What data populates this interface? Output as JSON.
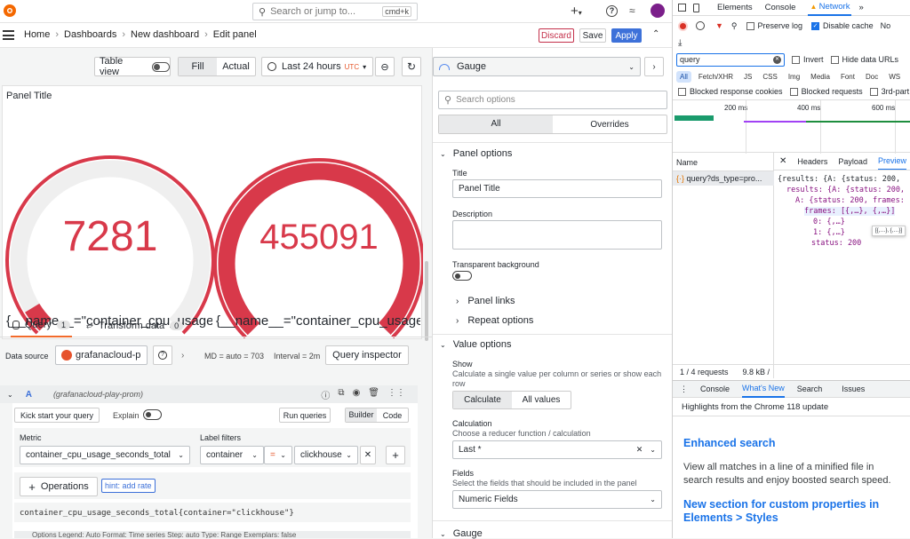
{
  "topbar": {
    "search_placeholder": "Search or jump to...",
    "search_shortcut": "cmd+k",
    "plus_label": "+"
  },
  "nav": {
    "breadcrumbs": [
      "Home",
      "Dashboards",
      "New dashboard",
      "Edit panel"
    ],
    "discard": "Discard",
    "save": "Save",
    "apply": "Apply"
  },
  "toolbar": {
    "table_view": "Table view",
    "fill": "Fill",
    "actual": "Actual",
    "time_range": "Last 24 hours",
    "tz": "UTC"
  },
  "panel": {
    "title": "Panel Title",
    "gauges": [
      {
        "value": "7281",
        "legend": "{__name__=\"container_cpu_usage...",
        "level": 0.05
      },
      {
        "value": "455091",
        "legend": "{__name__=\"container_cpu_usage...",
        "level": 1.0
      }
    ],
    "color": "#d8394a"
  },
  "query_tabs": {
    "query": "Query",
    "query_count": "1",
    "transform": "Transform data",
    "transform_count": "0"
  },
  "datasource": {
    "label": "Data source",
    "name": "grafanacloud-p",
    "md": "MD = auto = 703",
    "interval": "Interval = 2m",
    "inspector": "Query inspector"
  },
  "query": {
    "ref": "A",
    "source": "(grafanacloud-play-prom)",
    "kick": "Kick start your query",
    "explain": "Explain",
    "run": "Run queries",
    "builder": "Builder",
    "code": "Code",
    "metric_label": "Metric",
    "metric": "container_cpu_usage_seconds_total",
    "filters_label": "Label filters",
    "filter_key": "container",
    "filter_op": "=",
    "filter_value": "clickhouse",
    "operations": "Operations",
    "hint": "hint: add rate",
    "expr": "container_cpu_usage_seconds_total{container=\"clickhouse\"}",
    "options": "Options  Legend: Auto  Format: Time series  Step: auto  Type: Range  Exemplars: false"
  },
  "viz": {
    "type": "Gauge",
    "search_placeholder": "Search options",
    "tab_all": "All",
    "tab_overrides": "Overrides"
  },
  "panel_options": {
    "header": "Panel options",
    "title_label": "Title",
    "title_value": "Panel Title",
    "desc_label": "Description",
    "transparent": "Transparent background",
    "links": "Panel links",
    "repeat": "Repeat options"
  },
  "value_options": {
    "header": "Value options",
    "show_label": "Show",
    "show_desc": "Calculate a single value per column or series or show each row",
    "calculate": "Calculate",
    "all_values": "All values",
    "calc_label": "Calculation",
    "calc_desc": "Choose a reducer function / calculation",
    "calc_value": "Last *",
    "fields_label": "Fields",
    "fields_desc": "Select the fields that should be included in the panel",
    "fields_value": "Numeric Fields",
    "gauge_header": "Gauge"
  },
  "devtools": {
    "tabs": [
      "Elements",
      "Console",
      "Network"
    ],
    "preserve": "Preserve log",
    "disable_cache": "Disable cache",
    "no": "No",
    "filter_value": "query",
    "invert": "Invert",
    "hide_urls": "Hide data URLs",
    "types": [
      "All",
      "Fetch/XHR",
      "JS",
      "CSS",
      "Img",
      "Media",
      "Font",
      "Doc",
      "WS"
    ],
    "blocked_cookies": "Blocked response cookies",
    "blocked_requests": "Blocked requests",
    "third_party": "3rd-part",
    "timeline": [
      "200 ms",
      "400 ms",
      "600 ms"
    ],
    "name_col": "Name",
    "request": "query?ds_type=pro...",
    "detail_tabs": [
      "Headers",
      "Payload",
      "Preview"
    ],
    "preview_lines": [
      "{results: {A: {status: 200,",
      "results: {A: {status: 200,",
      "A: {status: 200, frames:",
      "frames: [{,…}, {,…}]",
      "0: {,…}",
      "1: {,…}",
      "status: 200"
    ],
    "tooltip": "[{,…}, {,…}]",
    "requests": "1 / 4 requests",
    "size": "9.8 kB /",
    "drawer_tabs": [
      "Console",
      "What's New",
      "Search",
      "Issues"
    ],
    "highlights": "Highlights from the Chrome 118 update",
    "news": [
      {
        "title": "Enhanced search",
        "body": "View all matches in a line of a minified file in search results and enjoy boosted search speed."
      },
      {
        "title": "New section for custom properties in Elements > Styles",
        "body": ""
      }
    ]
  }
}
